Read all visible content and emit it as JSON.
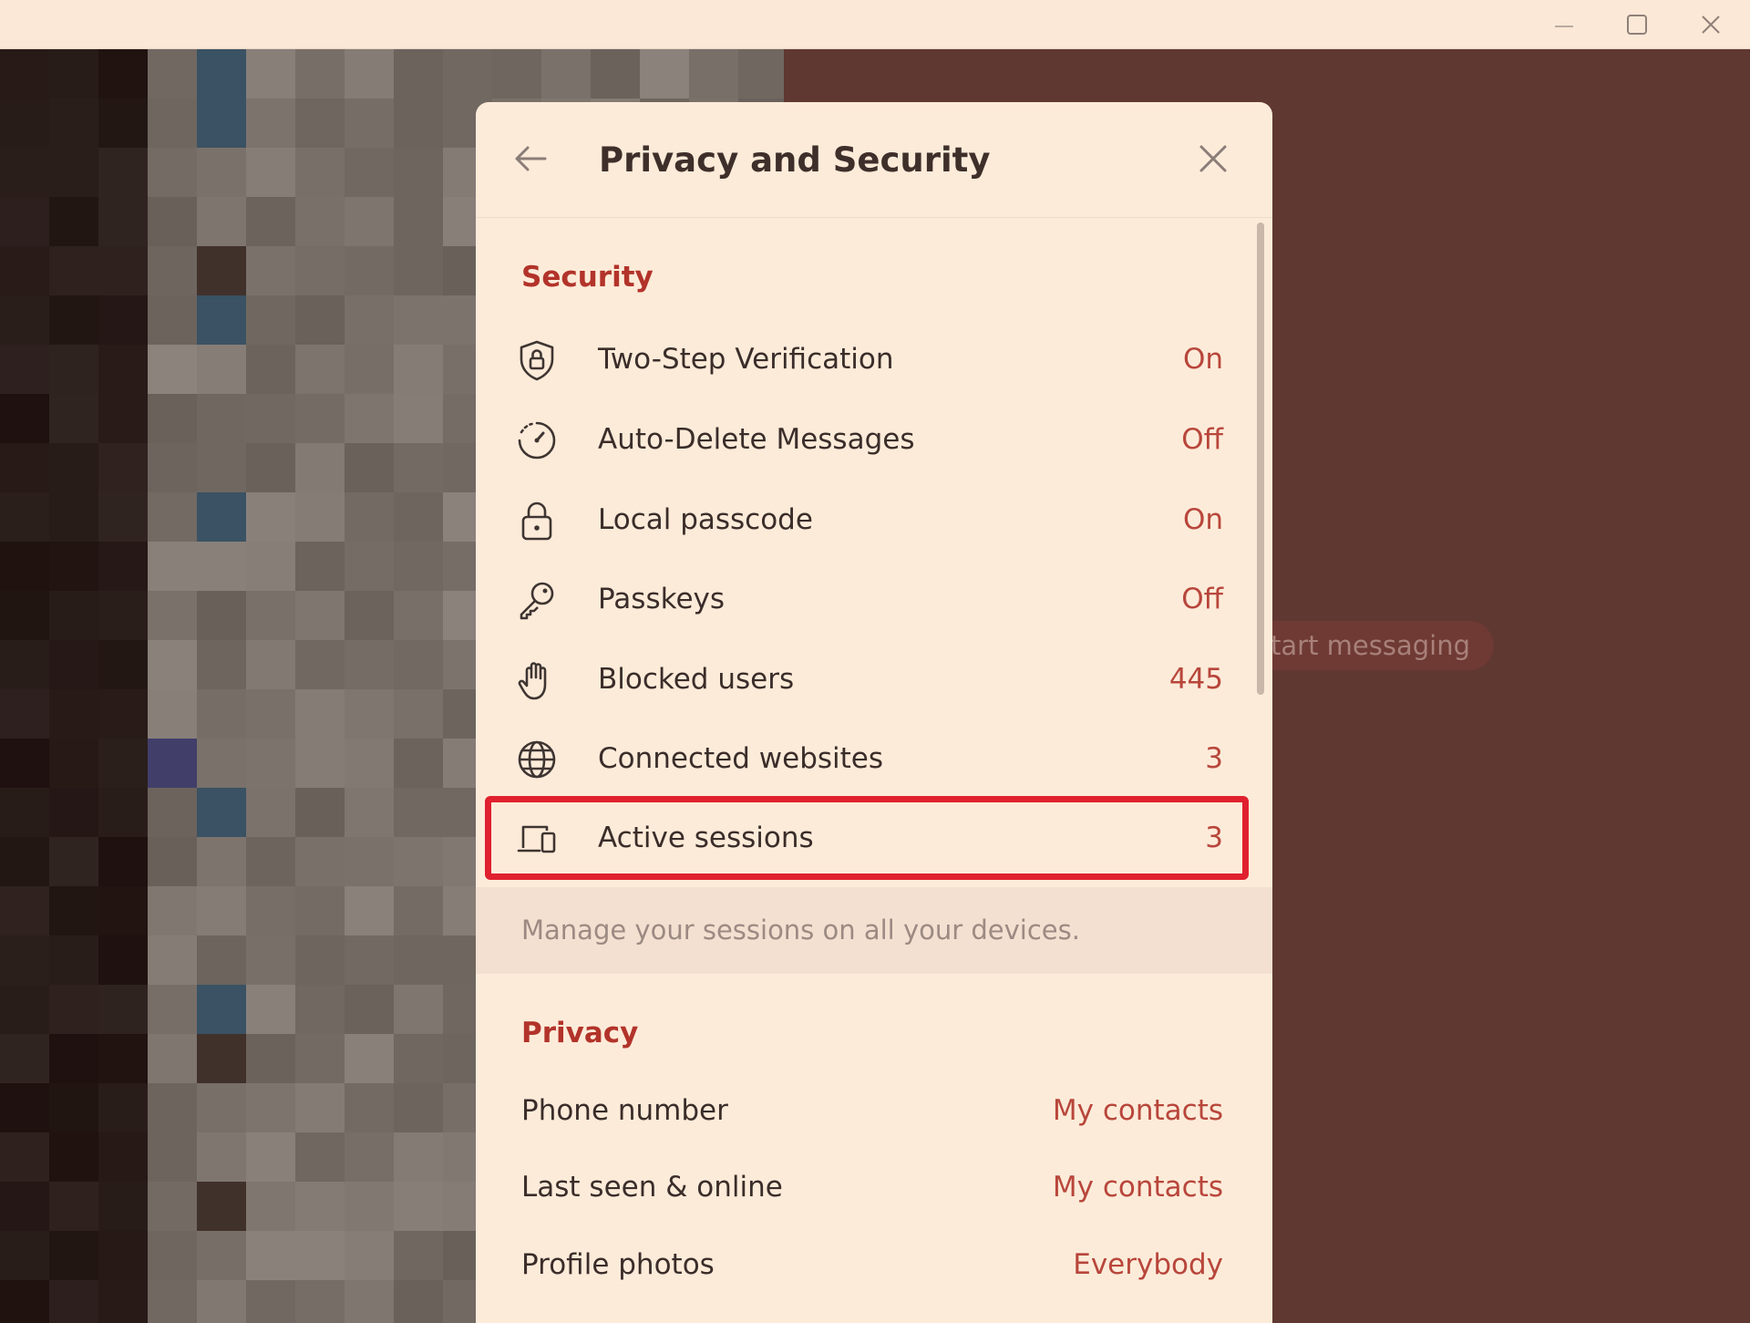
{
  "window": {
    "controls": [
      "minimize",
      "maximize",
      "close"
    ]
  },
  "background": {
    "hint_text": "start messaging"
  },
  "dialog": {
    "title": "Privacy and Security",
    "back_icon": "arrow-left-icon",
    "close_icon": "close-icon"
  },
  "security": {
    "title": "Security",
    "items": [
      {
        "label": "Two-Step Verification",
        "value": "On",
        "icon": "shield-lock-icon"
      },
      {
        "label": "Auto-Delete Messages",
        "value": "Off",
        "icon": "timer-icon"
      },
      {
        "label": "Local passcode",
        "value": "On",
        "icon": "lock-icon"
      },
      {
        "label": "Passkeys",
        "value": "Off",
        "icon": "key-icon"
      },
      {
        "label": "Blocked users",
        "value": "445",
        "icon": "hand-icon"
      },
      {
        "label": "Connected websites",
        "value": "3",
        "icon": "globe-icon"
      },
      {
        "label": "Active sessions",
        "value": "3",
        "icon": "devices-icon",
        "highlighted": true
      }
    ],
    "info": "Manage your sessions on all your devices."
  },
  "privacy": {
    "title": "Privacy",
    "items": [
      {
        "label": "Phone number",
        "value": "My contacts"
      },
      {
        "label": "Last seen & online",
        "value": "My contacts"
      },
      {
        "label": "Profile photos",
        "value": "Everybody"
      }
    ]
  },
  "colors": {
    "accent": "#b8463b",
    "section_title": "#b2332a",
    "dialog_bg": "#fdebd9",
    "highlight_border": "#e0202e",
    "chat_bg": "#5f3831"
  }
}
